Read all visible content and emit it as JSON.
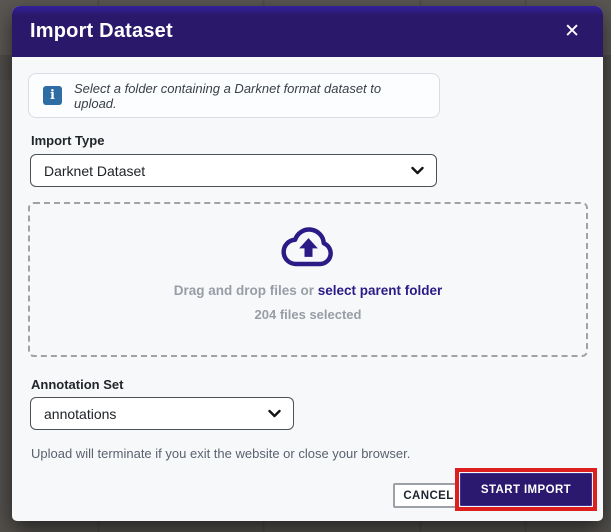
{
  "modal": {
    "title": "Import Dataset"
  },
  "icons": {
    "close": "✕",
    "info": "i"
  },
  "info_banner": {
    "text": "Select a folder containing a Darknet format dataset to upload."
  },
  "import_type": {
    "label": "Import Type",
    "selected": "Darknet Dataset"
  },
  "dropzone": {
    "drag_text": "Drag and drop files or ",
    "link_text": "select parent folder",
    "files_selected": "204 files selected"
  },
  "annotation_set": {
    "label": "Annotation Set",
    "selected": "annotations"
  },
  "footer": {
    "warning": "Upload will terminate if you exit the website or close your browser.",
    "cancel_label": "CANCEL",
    "start_label": "START IMPORT"
  },
  "colors": {
    "header_bg": "#2a196b",
    "accent_indigo": "#2b1b87",
    "info_icon_bg": "#2e6da4",
    "highlight_red": "#de1f1f",
    "body_bg": "#f7f8fa",
    "backdrop": "#53504c"
  }
}
